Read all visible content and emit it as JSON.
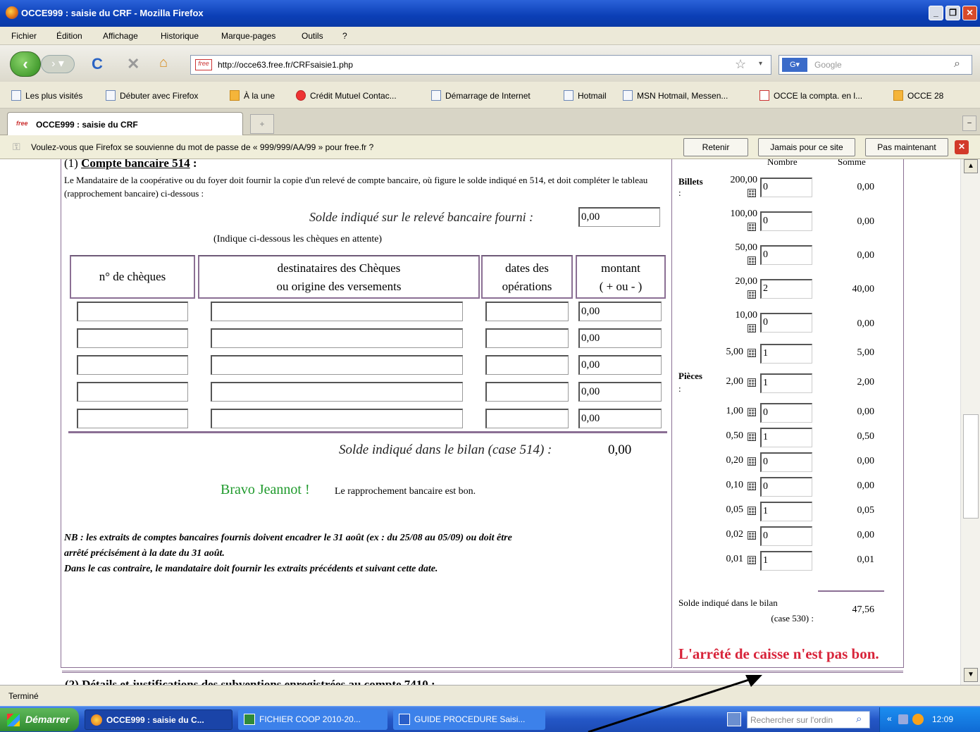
{
  "window": {
    "title": "OCCE999 : saisie du CRF - Mozilla Firefox"
  },
  "menu": [
    "Fichier",
    "Édition",
    "Affichage",
    "Historique",
    "Marque-pages",
    "Outils",
    "?"
  ],
  "nav": {
    "url": "http://occe63.free.fr/CRFsaisie1.php",
    "search_placeholder": "Google"
  },
  "bookmarks": [
    "Les plus visités",
    "Débuter avec Firefox",
    "À la une",
    "Crédit Mutuel Contac...",
    "Démarrage de Internet",
    "Hotmail",
    "MSN Hotmail, Messen...",
    "OCCE la compta. en l...",
    "OCCE 28"
  ],
  "tab": {
    "title": "OCCE999 : saisie du CRF"
  },
  "notification": {
    "message": "Voulez-vous que Firefox se souvienne du mot de passe de « 999/999/AA/99 » pour free.fr ?",
    "buttons": [
      "Retenir",
      "Jamais pour ce site",
      "Pas maintenant"
    ]
  },
  "bank": {
    "heading_num": "(1)",
    "heading": "Compte bancaire 514",
    "heading_tail": " :",
    "intro": "Le Mandataire de la coopérative ou du foyer doit fournir la copie d'un relevé de compte bancaire, où figure le solde indiqué en 514, et doit compléter le tableau (rapprochement bancaire) ci-dessous :",
    "solde_releve_label": "Solde indiqué sur le relevé bancaire fourni :",
    "solde_releve_value": "0,00",
    "cheques_hint": "(Indique ci-dessous les chèques en attente)",
    "col_cheques": "n° de chèques",
    "col_dest_1": "destinataires des Chèques",
    "col_dest_2": "ou origine des versements",
    "col_dates_1": "dates des",
    "col_dates_2": "opérations",
    "col_montant_1": "montant",
    "col_montant_2": "( + ou - )",
    "rows": [
      {
        "cheque": "",
        "dest": "",
        "date": "",
        "montant": "0,00"
      },
      {
        "cheque": "",
        "dest": "",
        "date": "",
        "montant": "0,00"
      },
      {
        "cheque": "",
        "dest": "",
        "date": "",
        "montant": "0,00"
      },
      {
        "cheque": "",
        "dest": "",
        "date": "",
        "montant": "0,00"
      },
      {
        "cheque": "",
        "dest": "",
        "date": "",
        "montant": "0,00"
      }
    ],
    "solde_bilan_label": "Solde indiqué dans le bilan (case 514) :",
    "solde_bilan_value": "0,00",
    "bravo": "Bravo Jeannot !",
    "bravo_msg": "Le rapprochement bancaire est bon.",
    "nb_1": "NB : les extraits de comptes bancaires fournis doivent encadrer le 31 août (ex : du 25/08 au 05/09) ou doit être",
    "nb_2": "arrêté précisément à la date du 31 août.",
    "nb_3": "Dans le cas contraire, le mandataire doit fournir les extraits précédents et suivant cette date.",
    "next_section": "(2) Détails et justifications des subventions enregistrées au compte 7410 :"
  },
  "cash": {
    "col_nombre": "Nombre",
    "col_somme": "Somme",
    "billets_label": "Billets",
    "pieces_label": "Pièces",
    "colon": ":",
    "billets": [
      {
        "val": "200,00",
        "nombre": "0",
        "somme": "0,00"
      },
      {
        "val": "100,00",
        "nombre": "0",
        "somme": "0,00"
      },
      {
        "val": "50,00",
        "nombre": "0",
        "somme": "0,00"
      },
      {
        "val": "20,00",
        "nombre": "2",
        "somme": "40,00"
      },
      {
        "val": "10,00",
        "nombre": "0",
        "somme": "0,00"
      }
    ],
    "pieces": [
      {
        "val": "5,00",
        "nombre": "1",
        "somme": "5,00"
      },
      {
        "val": "2,00",
        "nombre": "1",
        "somme": "2,00"
      },
      {
        "val": "1,00",
        "nombre": "0",
        "somme": "0,00"
      },
      {
        "val": "0,50",
        "nombre": "1",
        "somme": "0,50"
      },
      {
        "val": "0,20",
        "nombre": "0",
        "somme": "0,00"
      },
      {
        "val": "0,10",
        "nombre": "0",
        "somme": "0,00"
      },
      {
        "val": "0,05",
        "nombre": "1",
        "somme": "0,05"
      },
      {
        "val": "0,02",
        "nombre": "0",
        "somme": "0,00"
      },
      {
        "val": "0,01",
        "nombre": "1",
        "somme": "0,01"
      }
    ],
    "solde_label_1": "Solde indiqué dans le bilan",
    "solde_label_2": "(case 530) :",
    "solde_value": "47,56",
    "error": "L'arrêté de caisse n'est pas bon."
  },
  "status": "Terminé",
  "taskbar": {
    "start": "Démarrer",
    "tasks": [
      "OCCE999 : saisie du C...",
      "FICHIER COOP 2010-20...",
      "GUIDE PROCEDURE Saisi..."
    ],
    "search_placeholder": "Rechercher sur l'ordin",
    "clock": "12:09"
  }
}
